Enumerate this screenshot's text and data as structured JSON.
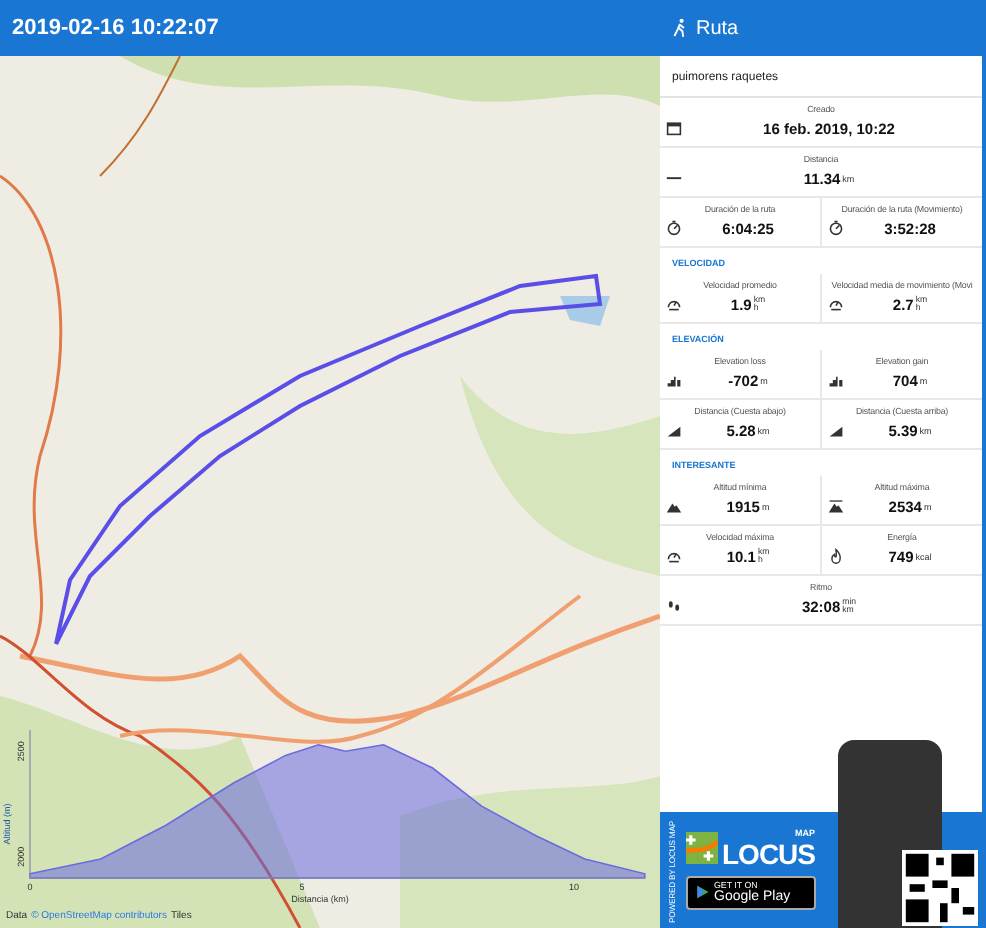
{
  "title_bar": {
    "datetime": "2019-02-16 10:22:07"
  },
  "map": {
    "chart_data": {
      "type": "area",
      "xlabel": "Distancia (km)",
      "ylabel": "Altitud (m)",
      "x": [
        0,
        1.3,
        2.5,
        3.75,
        4.7,
        5.3,
        5.8,
        6.5,
        7.4,
        8.3,
        9.3,
        10.2,
        11.3
      ],
      "series": [
        {
          "color": "#6a6ae0",
          "values": [
            1920,
            1990,
            2150,
            2350,
            2480,
            2530,
            2500,
            2530,
            2420,
            2240,
            2100,
            1990,
            1920
          ]
        }
      ],
      "xlim": [
        0,
        11.3
      ],
      "ylim": [
        1900,
        2600
      ],
      "xticks": [
        0,
        5,
        10
      ],
      "yticks": [
        2000,
        2500
      ]
    },
    "attribution": {
      "prefix": "Data",
      "link": "© OpenStreetMap contributors",
      "suffix": "Tiles"
    }
  },
  "panel": {
    "title": "Ruta",
    "track_name": "puimorens raquetes",
    "groups": [
      {
        "rows": [
          {
            "cells": [
              {
                "kind": "date",
                "label": "Creado",
                "value": "16 feb. 2019, 10:22"
              }
            ]
          },
          {
            "cells": [
              {
                "kind": "distance",
                "label": "Distancia",
                "value": "11.34",
                "unit": "km"
              }
            ]
          },
          {
            "cells": [
              {
                "kind": "duration",
                "label": "Duración de la ruta",
                "value": "6:04:25"
              },
              {
                "kind": "duration",
                "label": "Duración de la ruta (Movimiento)",
                "value": "3:52:28"
              }
            ]
          }
        ]
      },
      {
        "heading": "VELOCIDAD",
        "rows": [
          {
            "cells": [
              {
                "kind": "speed",
                "label": "Velocidad promedio",
                "value": "1.9",
                "unit_top": "km",
                "unit_bottom": "h"
              },
              {
                "kind": "speed-moving",
                "label": "Velocidad media de movimiento (Movi",
                "value": "2.7",
                "unit_top": "km",
                "unit_bottom": "h"
              }
            ]
          }
        ]
      },
      {
        "heading": "ELEVACIÓN",
        "rows": [
          {
            "cells": [
              {
                "kind": "ascent",
                "label": "Elevation loss",
                "value": "-702",
                "unit": "m"
              },
              {
                "kind": "ascent",
                "label": "Elevation gain",
                "value": "704",
                "unit": "m"
              }
            ]
          },
          {
            "cells": [
              {
                "kind": "slope",
                "label": "Distancia (Cuesta abajo)",
                "value": "5.28",
                "unit": "km"
              },
              {
                "kind": "slope",
                "label": "Distancia (Cuesta arriba)",
                "value": "5.39",
                "unit": "km"
              }
            ]
          }
        ]
      },
      {
        "heading": "INTERESANTE",
        "rows": [
          {
            "cells": [
              {
                "kind": "alt-min",
                "label": "Altitud mínima",
                "value": "1915",
                "unit": "m"
              },
              {
                "kind": "alt-max",
                "label": "Altitud máxima",
                "value": "2534",
                "unit": "m"
              }
            ]
          },
          {
            "cells": [
              {
                "kind": "speed",
                "label": "Velocidad máxima",
                "value": "10.1",
                "unit_top": "km",
                "unit_bottom": "h"
              },
              {
                "kind": "energy",
                "label": "Energía",
                "value": "749",
                "unit": "kcal"
              }
            ]
          },
          {
            "cells": [
              {
                "kind": "pace",
                "label": "Ritmo",
                "value": "32:08",
                "unit_top": "min",
                "unit_bottom": "km"
              }
            ]
          }
        ]
      }
    ]
  },
  "ad": {
    "side_text": "POWERED BY LOCUS MAP",
    "logo_small": "MAP",
    "logo": "LOCUS",
    "store_line1": "GET IT ON",
    "store_line2": "Google Play"
  }
}
